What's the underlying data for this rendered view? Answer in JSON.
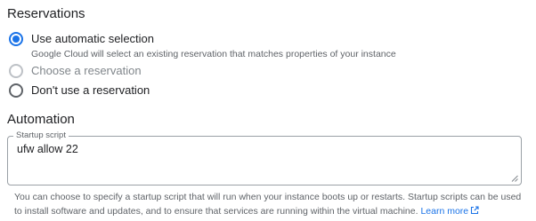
{
  "reservations": {
    "title": "Reservations",
    "options": [
      {
        "label": "Use automatic selection",
        "description": "Google Cloud will select an existing reservation that matches properties of your instance",
        "state": "selected"
      },
      {
        "label": "Choose a reservation",
        "state": "disabled"
      },
      {
        "label": "Don't use a reservation",
        "state": "unselected"
      }
    ]
  },
  "automation": {
    "title": "Automation",
    "startup_script": {
      "label": "Startup script",
      "value": "ufw allow 22"
    },
    "help_text": "You can choose to specify a startup script that will run when your instance boots up or restarts. Startup scripts can be used to install software and updates, and to ensure that services are running within the virtual machine.",
    "learn_more_label": "Learn more"
  },
  "colors": {
    "accent": "#1a73e8",
    "text": "#202124",
    "secondary_text": "#5f6368",
    "disabled": "#bdc1c6"
  },
  "icons": {
    "external_link": "external-link-icon",
    "resize": "resize-handle-icon"
  }
}
